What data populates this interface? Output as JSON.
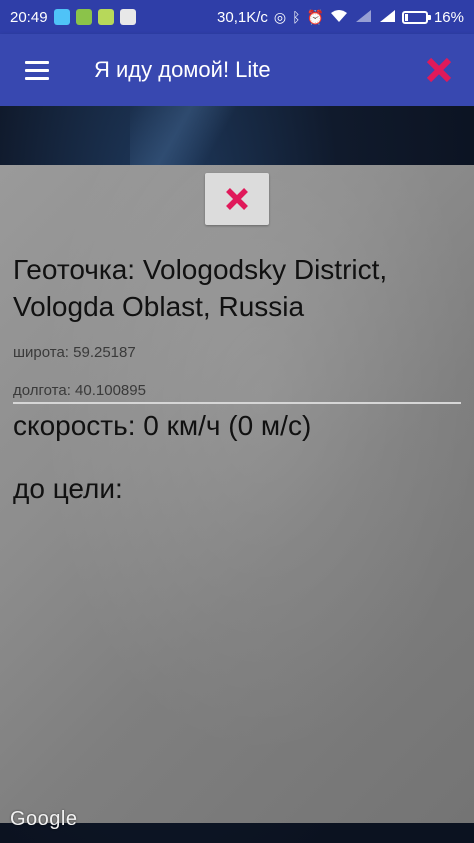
{
  "status_bar": {
    "time": "20:49",
    "speed": "30,1K/c",
    "battery": "16%",
    "battery_level": 0.16
  },
  "app_bar": {
    "title": "Я иду домой! Lite",
    "menu_icon": "hamburger-menu-icon",
    "close_icon": "close-icon"
  },
  "panel": {
    "geopoint": "Геоточка: Vologodsky District, Vologda Oblast, Russia",
    "latitude": "широта: 59.25187",
    "longitude": "долгота: 40.100895",
    "speed": "скорость: 0 км/ч (0 м/с)",
    "to_target": "до цели:"
  },
  "map": {
    "attribution": "Google"
  },
  "colors": {
    "app_bar": "#3848b0",
    "status_bar": "#2f3ea8",
    "close_accent": "#e0195a"
  }
}
